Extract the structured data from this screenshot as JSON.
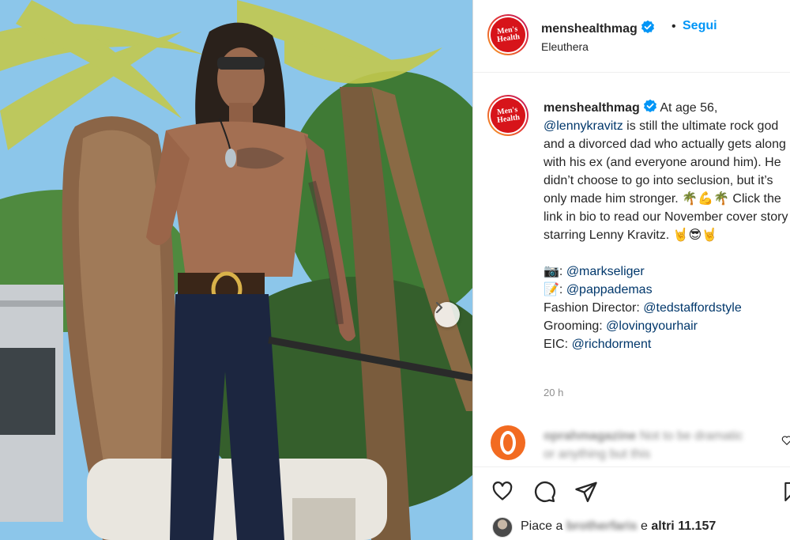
{
  "post": {
    "username": "menshealthmag",
    "verified": true,
    "separator": "•",
    "follow_label": "Segui",
    "location": "Eleuthera",
    "avatar_line1": "Men's",
    "avatar_line2": "Health"
  },
  "caption": {
    "username": "menshealthmag",
    "text_part1": " At age 56, ",
    "mention_lenny": "@lennykravitz",
    "text_part2": " is still the ultimate rock god and a divorced dad who actually gets along with his ex (and everyone around him). He didn’t choose to go into seclusion, but it’s only made him stronger. 🌴💪🌴 Click the link in bio to read our November cover story starring Lenny Kravitz. 🤘😎🤘",
    "credits": [
      {
        "prefix": "📷: ",
        "handle": "@markseliger"
      },
      {
        "prefix": "📝: ",
        "handle": "@pappademas"
      },
      {
        "prefix": "Fashion Director: ",
        "handle": "@tedstaffordstyle"
      },
      {
        "prefix": "Grooming: ",
        "handle": "@lovingyourhair"
      },
      {
        "prefix": "EIC: ",
        "handle": "@richdorment"
      }
    ],
    "time_ago": "20 h"
  },
  "comment": {
    "username": "oprahmagazine",
    "text": " Not to be dramatic or anything but this"
  },
  "likes": {
    "prefix": "Piace a ",
    "blurred_name": "brotherfaris",
    "suffix_plain": " e ",
    "suffix_bold": "altri 11.157"
  },
  "icons": {
    "verified": "verified-badge-icon",
    "next": "chevron-right-icon",
    "like": "heart-icon",
    "comment": "comment-icon",
    "share": "share-icon",
    "save": "bookmark-icon"
  },
  "colors": {
    "link": "#0095f6",
    "mention": "#00376b",
    "brand_red": "#d7141a",
    "muted": "#8e8e8e"
  }
}
